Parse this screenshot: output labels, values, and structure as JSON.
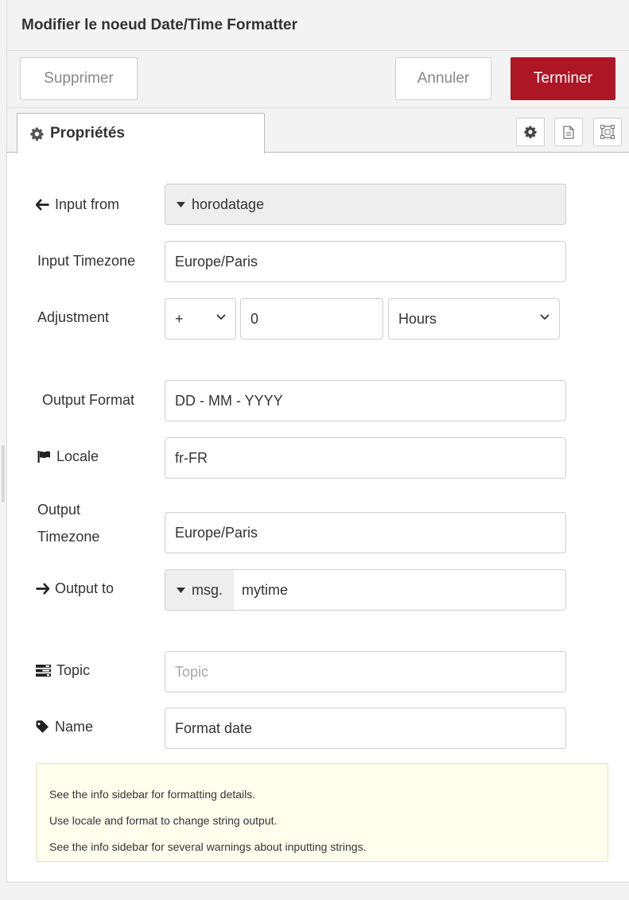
{
  "tray": {
    "title": "Modifier le noeud Date/Time Formatter",
    "buttons": {
      "delete": "Supprimer",
      "cancel": "Annuler",
      "done": "Terminer"
    },
    "tab": {
      "label": "Propriétés"
    }
  },
  "form": {
    "input_from": {
      "label": "Input from",
      "value": "horodatage"
    },
    "input_timezone": {
      "label": "Input Timezone",
      "value": "Europe/Paris"
    },
    "adjustment": {
      "label": "Adjustment",
      "sign": "+",
      "amount": "0",
      "unit": "Hours"
    },
    "output_format": {
      "label": "Output Format",
      "value": "DD - MM - YYYY"
    },
    "locale": {
      "label": "Locale",
      "value": "fr-FR"
    },
    "output_timezone": {
      "label_line1": "Output",
      "label_line2": "Timezone",
      "value": "Europe/Paris"
    },
    "output_to": {
      "label": "Output to",
      "prefix": "msg.",
      "value": "mytime"
    },
    "topic": {
      "label": "Topic",
      "value": "",
      "placeholder": "Topic"
    },
    "name": {
      "label": "Name",
      "value": "Format date"
    }
  },
  "tips": [
    "See the info sidebar for formatting details.",
    "Use locale and format to change string output.",
    "See the info sidebar for several warnings about inputting strings."
  ],
  "colors": {
    "primary_button": "#ad1625",
    "tips_background": "#ffffee",
    "panel_background": "#f3f3f3"
  },
  "icons": {
    "tab": "gear-icon",
    "tab_buttons": [
      "gear-icon",
      "document-icon",
      "frame-icon"
    ],
    "input_from": "arrow-left-icon",
    "locale": "flag-icon",
    "output_to": "arrow-right-icon",
    "topic": "tasks-icon",
    "name": "tag-icon"
  }
}
